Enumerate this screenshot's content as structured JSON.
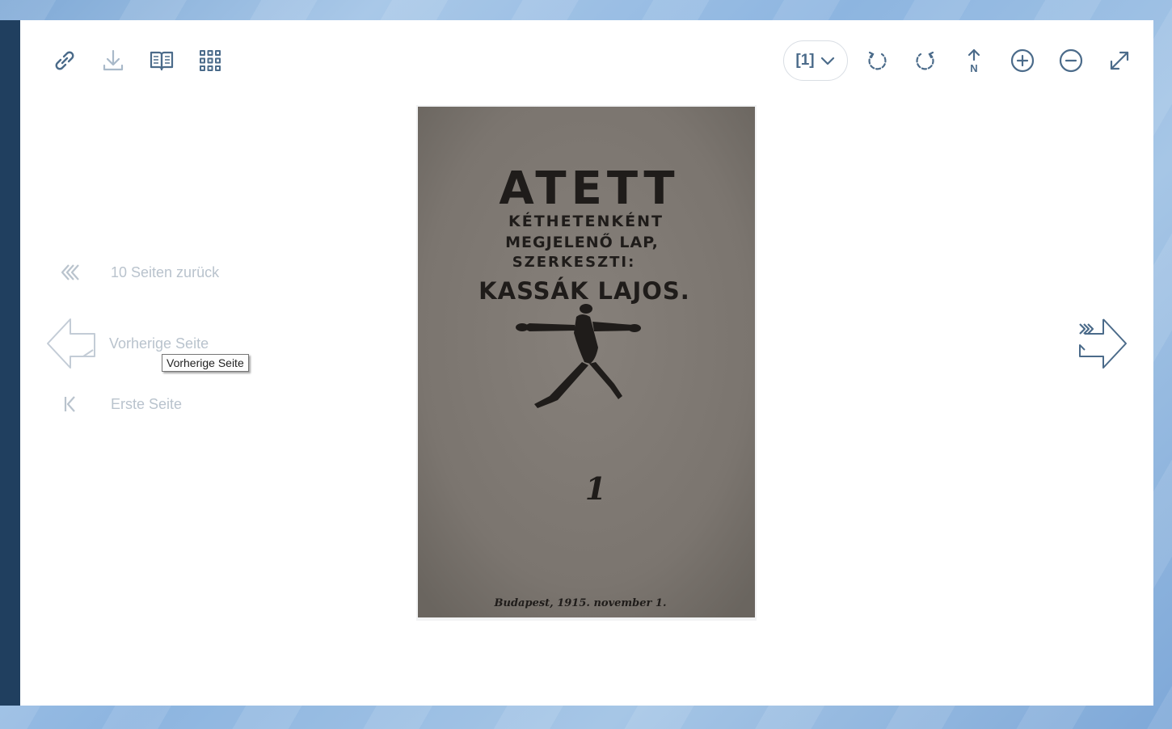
{
  "toolbar": {
    "left_icons": [
      "link-icon",
      "download-icon",
      "book-icon",
      "grid-icon"
    ],
    "page_select_value": "[1]",
    "right_icons": [
      "rotate-left-icon",
      "rotate-right-icon",
      "north-icon",
      "zoom-in-icon",
      "zoom-out-icon",
      "fullscreen-icon"
    ],
    "north_letter": "N",
    "icon_color": "#4b6b8a"
  },
  "nav": {
    "back10_label": "10 Seiten zurück",
    "prev_label": "Vorherige Seite",
    "first_label": "Erste Seite",
    "tooltip": "Vorherige Seite",
    "disabled_color": "#b9c3cd"
  },
  "document": {
    "title": "ATETT",
    "subtitle_line1": "KÉTHETENKÉNT",
    "subtitle_line2": "MEGJELENŐ LAP,",
    "subtitle_line3": "SZERKESZTI:",
    "editor": "KASSÁK LAJOS.",
    "issue_number": "1",
    "footer": "Budapest, 1915. november 1."
  }
}
